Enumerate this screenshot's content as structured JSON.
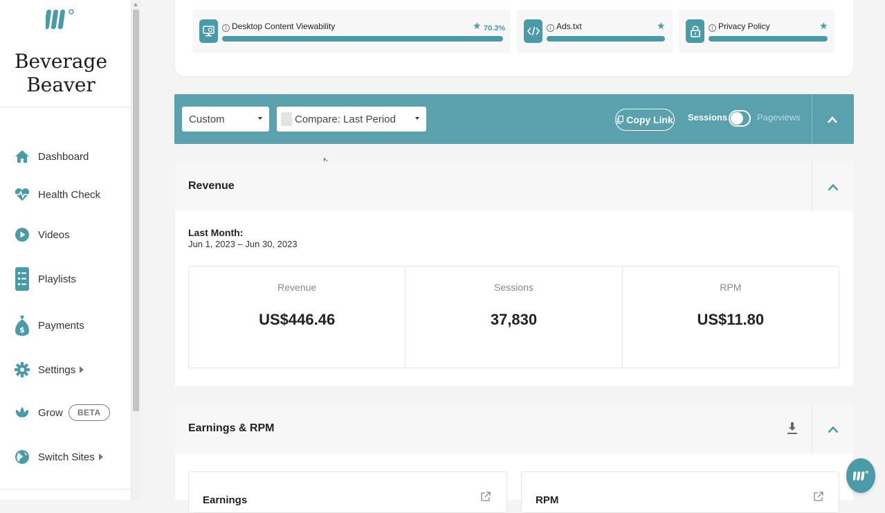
{
  "sidebar": {
    "site_title_line1": "Beverage",
    "site_title_line2": "Beaver",
    "items": [
      {
        "label": "Dashboard",
        "icon": "home-icon"
      },
      {
        "label": "Health Check",
        "icon": "heartbeat-icon"
      },
      {
        "label": "Videos",
        "icon": "play-icon"
      },
      {
        "label": "Playlists",
        "icon": "playlist-icon"
      },
      {
        "label": "Payments",
        "icon": "money-bag-icon"
      },
      {
        "label": "Settings",
        "icon": "gear-icon"
      },
      {
        "label": "Grow",
        "icon": "grow-icon",
        "badge": "BETA"
      },
      {
        "label": "Switch Sites",
        "icon": "globe-icon"
      }
    ]
  },
  "health": {
    "tiles": [
      {
        "label": "Desktop Content Viewability",
        "value": "70.3%",
        "icon": "monitor-icon"
      },
      {
        "label": "Ads.txt",
        "icon": "code-icon"
      },
      {
        "label": "Privacy Policy",
        "icon": "lock-icon"
      }
    ]
  },
  "filters": {
    "range_value": "Custom",
    "compare_value": "Compare: Last Period",
    "copy_link_label": "Copy Link",
    "toggle_left": "Sessions",
    "toggle_right": "Pageviews"
  },
  "revenue": {
    "title": "Revenue",
    "period_title": "Last Month:",
    "period_range": "Jun 1, 2023 – Jun 30, 2023",
    "stats": [
      {
        "label": "Revenue",
        "value": "US$446.46"
      },
      {
        "label": "Sessions",
        "value": "37,830"
      },
      {
        "label": "RPM",
        "value": "US$11.80"
      }
    ]
  },
  "earnings": {
    "title": "Earnings & RPM",
    "cards": [
      {
        "title": "Earnings"
      },
      {
        "title": "RPM"
      }
    ]
  },
  "colors": {
    "accent": "#5aa0ad",
    "accent_dark": "#4a9aa8"
  }
}
